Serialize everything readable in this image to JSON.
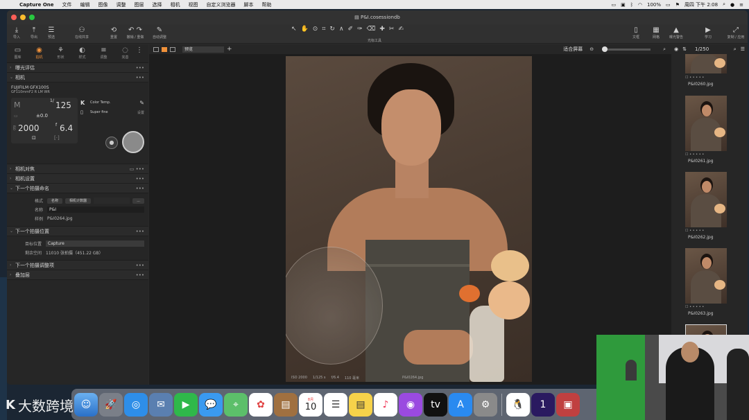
{
  "menubar": {
    "app": "Capture One",
    "items": [
      "文件",
      "编辑",
      "图像",
      "调整",
      "图层",
      "选择",
      "相机",
      "视图",
      "自定义浏览器",
      "脚本",
      "帮助"
    ],
    "battery": "100%",
    "clock": "周四 下午 2:08"
  },
  "window": {
    "title": "P&I.cosessiondb"
  },
  "toolbar": {
    "left": [
      {
        "icon": "import-icon",
        "label": "导入"
      },
      {
        "icon": "export-icon",
        "label": "导出"
      },
      {
        "icon": "presets-icon",
        "label": "预选"
      },
      {
        "icon": "share-icon",
        "label": "在线共享"
      },
      {
        "icon": "reset-icon",
        "label": "重置"
      },
      {
        "icon": "undo-redo-icon",
        "label": "撤销 / 重做"
      },
      {
        "icon": "auto-adjust-icon",
        "label": "自动调整"
      }
    ],
    "cursor_label": "光标工具",
    "right": [
      {
        "icon": "text-icon",
        "label": "文框"
      },
      {
        "icon": "grid-icon",
        "label": "网格"
      },
      {
        "icon": "exposure-warning-icon",
        "label": "曝光警告"
      },
      {
        "icon": "learn-icon",
        "label": "学习"
      },
      {
        "icon": "copy-apply-icon",
        "label": "复制 / 应用"
      }
    ]
  },
  "tool_tabs": [
    {
      "icon": "library-icon",
      "label": "图库"
    },
    {
      "icon": "camera-icon",
      "label": "拍机"
    },
    {
      "icon": "shape-icon",
      "label": "形状"
    },
    {
      "icon": "style-icon",
      "label": "样式"
    },
    {
      "icon": "adjust-icon",
      "label": "调整"
    },
    {
      "icon": "finish-icon",
      "label": "完善"
    }
  ],
  "sections": {
    "exposure": "曝光评估",
    "camera": "相机",
    "camera_focus": "相机对焦",
    "camera_settings": "相机设置",
    "next_naming": "下一个拍摄命名",
    "next_location": "下一个拍摄位置",
    "next_adjust": "下一个拍摄调整项",
    "overlay": "叠加层"
  },
  "camera": {
    "model": "FUJIFILM GFX100S",
    "lens": "GF110mmF2 R LM WR",
    "mode": "M",
    "shutter_prefix": "1/",
    "shutter": "125",
    "ev": "±0.0",
    "iso_prefix": "ISO",
    "iso": "2000",
    "aperture_prefix": "f",
    "aperture": "6.4",
    "kelvin": "K",
    "white_balance": "Color Temp.",
    "quality": "Super fine",
    "settings_label": "设置"
  },
  "naming": {
    "format_label": "格式",
    "format_tokens": [
      "名称",
      "相机计数器"
    ],
    "name_label": "名称",
    "name_value": "P&I",
    "sample_label": "样例",
    "sample_value": "P&I0264.jpg"
  },
  "location": {
    "target_label": "目标位置",
    "target_value": "Capture",
    "space_label": "剩余空间",
    "space_value": "11010 张拍摄（451.22 GB）"
  },
  "viewer": {
    "view_mode": "预览",
    "fit_label": "适合屏幕",
    "info": [
      "ISO 2000",
      "1/125 s",
      "f/6.4",
      "110 毫米"
    ],
    "filename": "P&I0264.jpg"
  },
  "browser": {
    "count": "1/250",
    "thumbs": [
      {
        "name": "P&I0260.jpg"
      },
      {
        "name": "P&I0261.jpg"
      },
      {
        "name": "P&I0262.jpg"
      },
      {
        "name": "P&I0263.jpg"
      }
    ],
    "rating_dots": "• • • • •"
  },
  "dock": {
    "calendar_month": "8月",
    "calendar_day": "10"
  },
  "watermark": {
    "logo": "K",
    "text": "大数跨境"
  },
  "colors": {
    "accent": "#f0913a",
    "panel": "#262626",
    "viewer_bg": "#1d1d1d"
  }
}
